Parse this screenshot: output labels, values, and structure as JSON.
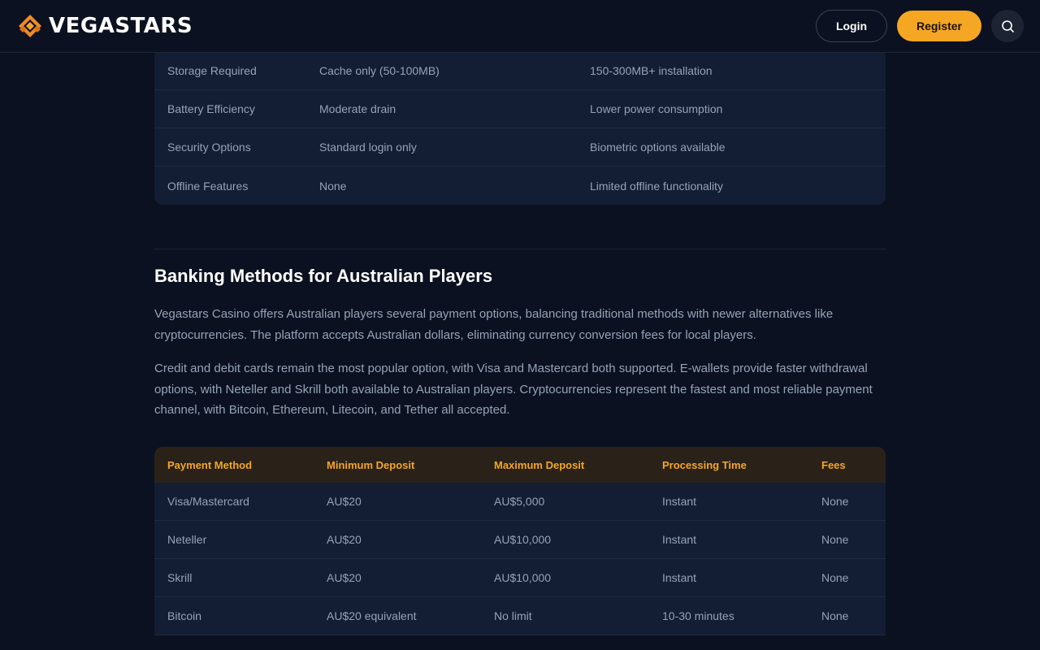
{
  "header": {
    "logo_text": "VEGASTARS",
    "login_label": "Login",
    "register_label": "Register",
    "search_icon": "search-icon",
    "accent_color": "#f5a623"
  },
  "comparison_table": {
    "rows": [
      [
        "Storage Required",
        "Cache only (50-100MB)",
        "150-300MB+ installation"
      ],
      [
        "Battery Efficiency",
        "Moderate drain",
        "Lower power consumption"
      ],
      [
        "Security Options",
        "Standard login only",
        "Biometric options available"
      ],
      [
        "Offline Features",
        "None",
        "Limited offline functionality"
      ]
    ]
  },
  "banking": {
    "title": "Banking Methods for Australian Players",
    "paragraphs": [
      "Vegastars Casino offers Australian players several payment options, balancing traditional methods with newer alternatives like cryptocurrencies. The platform accepts Australian dollars, eliminating currency conversion fees for local players.",
      "Credit and debit cards remain the most popular option, with Visa and Mastercard both supported. E-wallets provide faster withdrawal options, with Neteller and Skrill both available to Australian players. Cryptocurrencies represent the fastest and most reliable payment channel, with Bitcoin, Ethereum, Litecoin, and Tether all accepted."
    ],
    "table": {
      "headers": [
        "Payment Method",
        "Minimum Deposit",
        "Maximum Deposit",
        "Processing Time",
        "Fees"
      ],
      "rows": [
        [
          "Visa/Mastercard",
          "AU$20",
          "AU$5,000",
          "Instant",
          "None"
        ],
        [
          "Neteller",
          "AU$20",
          "AU$10,000",
          "Instant",
          "None"
        ],
        [
          "Skrill",
          "AU$20",
          "AU$10,000",
          "Instant",
          "None"
        ],
        [
          "Bitcoin",
          "AU$20 equivalent",
          "No limit",
          "10-30 minutes",
          "None"
        ]
      ]
    }
  }
}
